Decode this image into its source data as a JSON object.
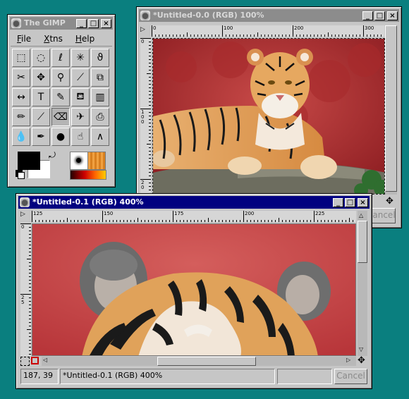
{
  "toolbox": {
    "title": "The GIMP",
    "menu": [
      {
        "label": "File",
        "accel": "F",
        "rest": "ile"
      },
      {
        "label": "Xtns",
        "accel": "X",
        "rest": "tns"
      },
      {
        "label": "Help",
        "accel": "H",
        "rest": "elp"
      }
    ],
    "tools": [
      {
        "name": "rect-select-tool",
        "glyph": "⬚"
      },
      {
        "name": "ellipse-select-tool",
        "glyph": "◌"
      },
      {
        "name": "free-select-tool",
        "glyph": "ℓ"
      },
      {
        "name": "fuzzy-select-tool",
        "glyph": "✳"
      },
      {
        "name": "bezier-select-tool",
        "glyph": "ϑ"
      },
      {
        "name": "intelligent-scissors-tool",
        "glyph": "✂"
      },
      {
        "name": "move-tool",
        "glyph": "✥"
      },
      {
        "name": "magnify-tool",
        "glyph": "⚲"
      },
      {
        "name": "crop-tool",
        "glyph": "⟋"
      },
      {
        "name": "transform-tool",
        "glyph": "⧉"
      },
      {
        "name": "flip-tool",
        "glyph": "↔"
      },
      {
        "name": "text-tool",
        "glyph": "T"
      },
      {
        "name": "color-picker-tool",
        "glyph": "✎"
      },
      {
        "name": "bucket-fill-tool",
        "glyph": "⛾"
      },
      {
        "name": "blend-tool",
        "glyph": "▥"
      },
      {
        "name": "pencil-tool",
        "glyph": "✏"
      },
      {
        "name": "paintbrush-tool",
        "glyph": "⟋"
      },
      {
        "name": "eraser-tool",
        "glyph": "⌫"
      },
      {
        "name": "airbrush-tool",
        "glyph": "✈"
      },
      {
        "name": "clone-tool",
        "glyph": "⎙"
      },
      {
        "name": "blur-tool",
        "glyph": "💧"
      },
      {
        "name": "ink-tool",
        "glyph": "✒"
      },
      {
        "name": "dodge-burn-tool",
        "glyph": "●"
      },
      {
        "name": "smudge-tool",
        "glyph": "☝"
      },
      {
        "name": "measure-tool",
        "glyph": "∧"
      }
    ],
    "active_tool_index": 17
  },
  "window_main": {
    "title": "*Untitled-0.0 (RGB) 100%",
    "ruler_top": [
      "0",
      "100",
      "200",
      "300"
    ],
    "ruler_left": [
      "0",
      "1 0 0",
      "2 0"
    ],
    "cancel_label": "Cancel"
  },
  "window_zoom": {
    "title": "*Untitled-0.1 (RGB) 400%",
    "ruler_top": [
      "125",
      "150",
      "175",
      "200",
      "225"
    ],
    "ruler_left": [
      "0",
      "2 5"
    ],
    "status_coords": "187, 39",
    "status_text": "*Untitled-0.1 (RGB) 400%",
    "cancel_label": "Cancel"
  },
  "colors": {
    "desktop": "#0a7f7f",
    "active_title": "#000080",
    "inactive_title": "#8c8c8c",
    "foreground": "#000000",
    "background": "#ffffff"
  }
}
